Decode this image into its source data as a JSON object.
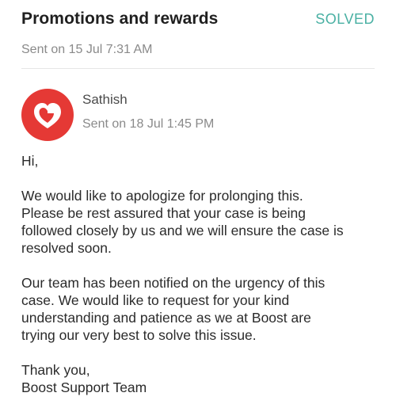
{
  "header": {
    "title": "Promotions and rewards",
    "status": "SOLVED",
    "status_color": "#49b0a3",
    "sent": "Sent on 15 Jul 7:31 AM"
  },
  "message": {
    "avatar_icon": "boost-heart-logo-icon",
    "avatar_color": "#e53935",
    "sender": "Sathish",
    "sent": "Sent on 18 Jul 1:45 PM",
    "greeting": "Hi,",
    "paragraph1": [
      "We would like to apologize for prolonging this.",
      "Please be rest assured that your case is being",
      "followed closely by us and we will ensure the case is",
      "resolved soon."
    ],
    "paragraph2": [
      "Our team has been notified on the urgency of this",
      "case. We would like to request for your kind",
      "understanding and patience as we at Boost are",
      "trying our very best to solve this issue."
    ],
    "closing": [
      "Thank you,",
      "Boost Support Team"
    ]
  }
}
